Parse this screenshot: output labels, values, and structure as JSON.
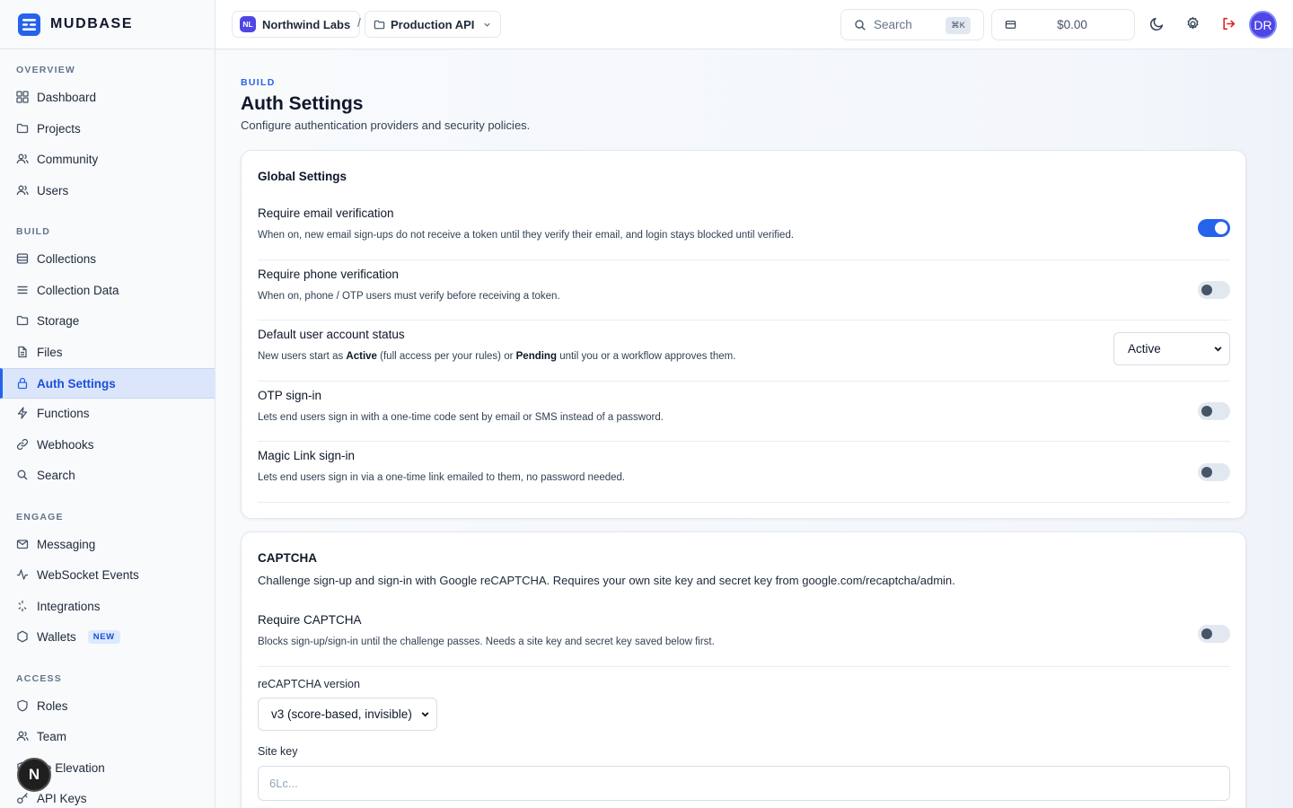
{
  "app": {
    "name": "MUDBASE",
    "brand_color": "#2563eb"
  },
  "sidebar": {
    "sections": [
      {
        "label": "OVERVIEW",
        "items": [
          {
            "label": "Dashboard",
            "icon": "grid-icon"
          },
          {
            "label": "Projects",
            "icon": "folder-icon"
          },
          {
            "label": "Community",
            "icon": "users-icon"
          },
          {
            "label": "Users",
            "icon": "users-icon"
          }
        ]
      },
      {
        "label": "BUILD",
        "items": [
          {
            "label": "Collections",
            "icon": "database-icon"
          },
          {
            "label": "Collection Data",
            "icon": "list-icon"
          },
          {
            "label": "Storage",
            "icon": "folder-icon"
          },
          {
            "label": "Files",
            "icon": "file-icon"
          },
          {
            "label": "Auth Settings",
            "icon": "lock-icon",
            "active": true
          },
          {
            "label": "Functions",
            "icon": "bolt-icon"
          },
          {
            "label": "Webhooks",
            "icon": "link-icon"
          },
          {
            "label": "Search",
            "icon": "search-icon"
          }
        ]
      },
      {
        "label": "ENGAGE",
        "items": [
          {
            "label": "Messaging",
            "icon": "mail-icon"
          },
          {
            "label": "WebSocket Events",
            "icon": "activity-icon"
          },
          {
            "label": "Integrations",
            "icon": "sparkle-icon"
          },
          {
            "label": "Wallets",
            "icon": "hexagon-icon",
            "badge": "NEW"
          }
        ]
      },
      {
        "label": "ACCESS",
        "items": [
          {
            "label": "Roles",
            "icon": "shield-icon"
          },
          {
            "label": "Team",
            "icon": "users-icon"
          },
          {
            "label": "le Elevation",
            "icon": "shield-icon"
          },
          {
            "label": "API Keys",
            "icon": "key-icon"
          }
        ]
      }
    ],
    "floating_button": "N"
  },
  "header": {
    "org": {
      "initials": "NL",
      "name": "Northwind Labs"
    },
    "separator": "/",
    "project": {
      "name": "Production API"
    },
    "search": {
      "placeholder": "Search",
      "shortcut": "⌘K"
    },
    "balance": "$0.00",
    "user_initials": "DR"
  },
  "page": {
    "eyebrow": "BUILD",
    "title": "Auth Settings",
    "subtitle": "Configure authentication providers and security policies."
  },
  "global_settings": {
    "title": "Global Settings",
    "rows": [
      {
        "title": "Require email verification",
        "desc": "When on, new email sign-ups do not receive a token until they verify their email, and login stays blocked until verified.",
        "enabled": true
      },
      {
        "title": "Require phone verification",
        "desc": "When on, phone / OTP users must verify before receiving a token.",
        "enabled": false
      },
      {
        "title": "Default user account status",
        "desc_parts": {
          "a": "New users start as ",
          "b": "Active",
          "c": " (full access per your rules) or ",
          "d": "Pending",
          "e": " until you or a workflow approves them."
        },
        "select_value": "Active"
      },
      {
        "title": "OTP sign-in",
        "desc": "Lets end users sign in with a one-time code sent by email or SMS instead of a password.",
        "enabled": false
      },
      {
        "title": "Magic Link sign-in",
        "desc": "Lets end users sign in via a one-time link emailed to them, no password needed.",
        "enabled": false
      }
    ]
  },
  "captcha": {
    "title": "CAPTCHA",
    "description": "Challenge sign-up and sign-in with Google reCAPTCHA. Requires your own site key and secret key from google.com/recaptcha/admin.",
    "require": {
      "title": "Require CAPTCHA",
      "desc": "Blocks sign-up/sign-in until the challenge passes. Needs a site key and secret key saved below first.",
      "enabled": false
    },
    "version_label": "reCAPTCHA version",
    "version_value": "v3 (score-based, invisible)",
    "site_key_label": "Site key",
    "site_key_placeholder": "6Lc..."
  }
}
